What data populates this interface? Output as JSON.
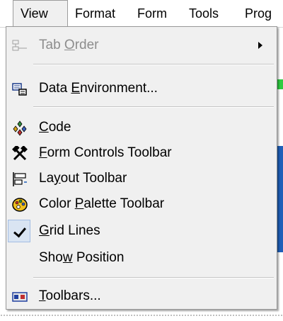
{
  "menubar": {
    "items": [
      {
        "label": "View",
        "active": true
      },
      {
        "label": "Format",
        "active": false
      },
      {
        "label": "Form",
        "active": false
      },
      {
        "label": "Tools",
        "active": false
      },
      {
        "label": "Prog",
        "active": false
      }
    ]
  },
  "menu": {
    "items": [
      {
        "label": "Tab Order",
        "mnemonic": "O",
        "icon": "tab-order-icon",
        "enabled": false,
        "submenu": true
      },
      {
        "label": "Data Environment...",
        "mnemonic": "E",
        "icon": "data-environment-icon",
        "enabled": true,
        "submenu": false
      },
      {
        "label": "Code",
        "mnemonic": "C",
        "icon": "code-icon",
        "enabled": true,
        "submenu": false
      },
      {
        "label": "Form Controls Toolbar",
        "mnemonic": "F",
        "icon": "form-controls-toolbar-icon",
        "enabled": true,
        "submenu": false
      },
      {
        "label": "Layout Toolbar",
        "mnemonic": "y",
        "icon": "layout-toolbar-icon",
        "enabled": true,
        "submenu": false
      },
      {
        "label": "Color Palette Toolbar",
        "mnemonic": "P",
        "icon": "color-palette-icon",
        "enabled": true,
        "submenu": false
      },
      {
        "label": "Grid Lines",
        "mnemonic": "G",
        "icon": "check-icon",
        "enabled": true,
        "checked": true,
        "submenu": false
      },
      {
        "label": "Show Position",
        "mnemonic": "w",
        "icon": "",
        "enabled": true,
        "submenu": false
      },
      {
        "label": "Toolbars...",
        "mnemonic": "T",
        "icon": "toolbars-icon",
        "enabled": true,
        "submenu": false
      }
    ]
  },
  "colors": {
    "menu_background": "#f0f0f0",
    "disabled_text": "#8d8d8d",
    "check_highlight": "#d9e4f2",
    "window_accent_green": "#2ecc40",
    "window_accent_blue": "#1f5fb8"
  }
}
